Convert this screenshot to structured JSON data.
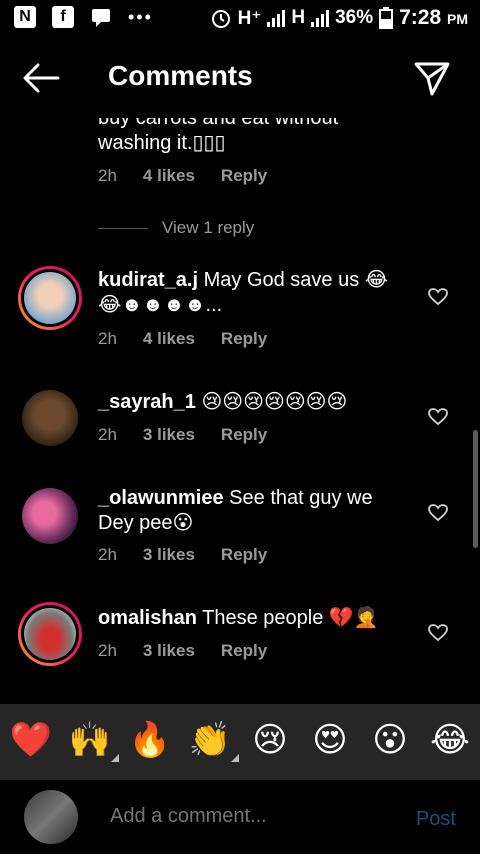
{
  "status_bar": {
    "network_hplus": "H⁺",
    "network_h": "H",
    "battery": "36%",
    "time": "7:28",
    "ampm": "PM"
  },
  "header": {
    "title": "Comments"
  },
  "comments": [
    {
      "username": "",
      "text": "buy carrots and eat without washing it.▯▯▯",
      "time": "2h",
      "likes": "4 likes",
      "reply": "Reply",
      "view_replies": "View 1 reply"
    },
    {
      "username": "kudirat_a.j",
      "text": "May God save us 😂😂☻☻☻☻...",
      "time": "2h",
      "likes": "4 likes",
      "reply": "Reply"
    },
    {
      "username": "_sayrah_1",
      "text": "😢😢😢😢😢😢😢",
      "time": "2h",
      "likes": "3 likes",
      "reply": "Reply"
    },
    {
      "username": "_olawunmiee",
      "text": "See that guy we Dey pee😮",
      "time": "2h",
      "likes": "3 likes",
      "reply": "Reply"
    },
    {
      "username": "omalishan",
      "text": "These people 💔🤦",
      "time": "2h",
      "likes": "3 likes",
      "reply": "Reply"
    }
  ],
  "emoji_tray": [
    "❤️",
    "🙌",
    "🔥",
    "👏",
    "😢",
    "😍",
    "😮",
    "😂"
  ],
  "composer": {
    "placeholder": "Add a comment...",
    "post_label": "Post"
  },
  "colors": {
    "background": "#000000",
    "tray": "#262626",
    "muted_text": "#9a9a9a",
    "post_disabled": "#1e4f7a",
    "story_ring": "#e91e63"
  }
}
